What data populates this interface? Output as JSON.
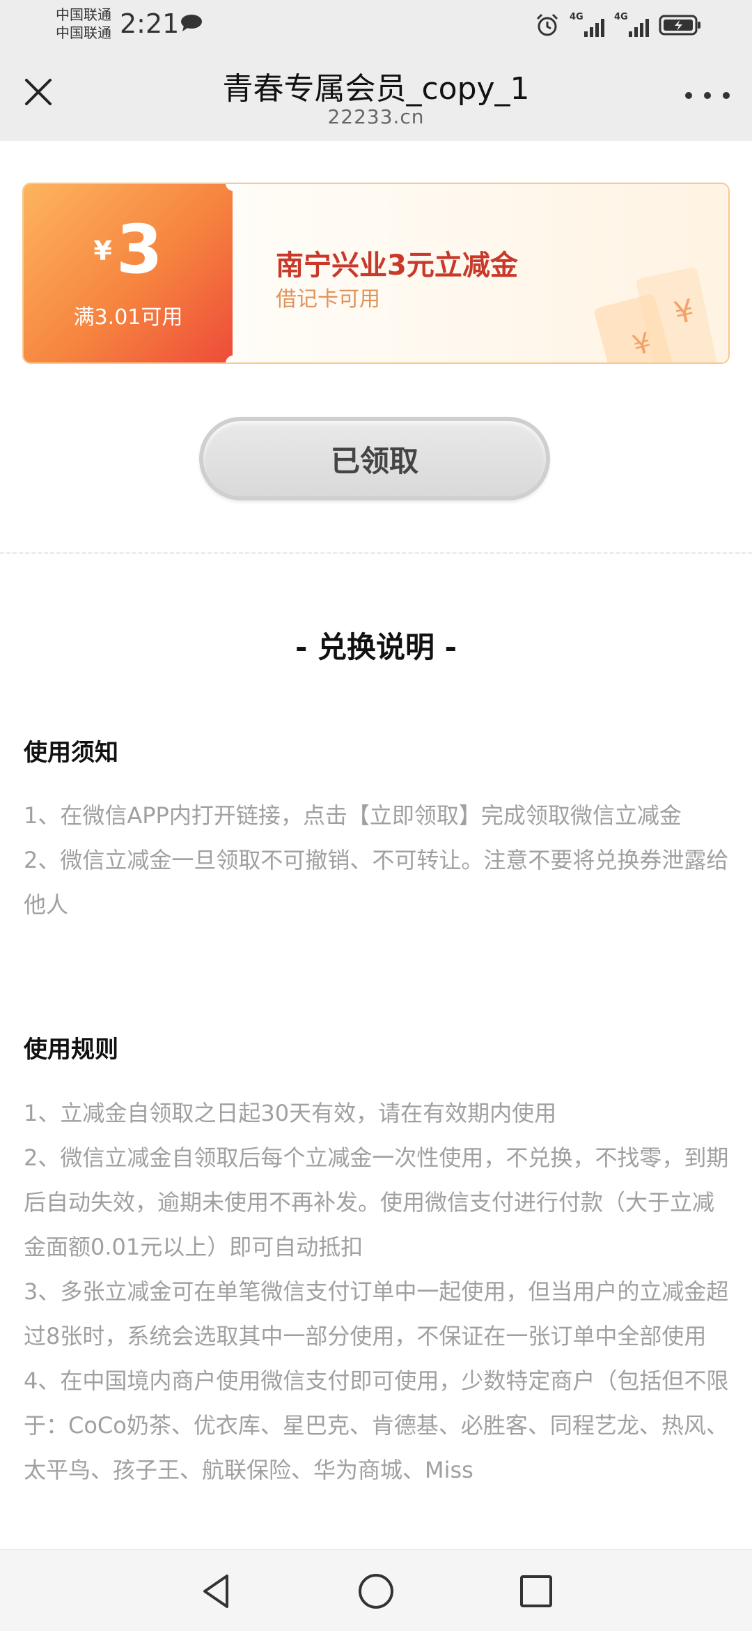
{
  "status_bar": {
    "carrier_1": "中国联通",
    "carrier_2": "中国联通",
    "time": "2:21",
    "network_1": "4G",
    "network_2": "4G"
  },
  "nav": {
    "title": "青春专属会员_copy_1",
    "domain": "22233.cn"
  },
  "coupon": {
    "currency": "¥",
    "amount": "3",
    "threshold": "满3.01可用",
    "title": "南宁兴业3元立减金",
    "subtitle": "借记卡可用"
  },
  "claimed_button": "已领取",
  "section_heading": "- 兑换说明 -",
  "usage_notice": {
    "heading": "使用须知",
    "items": [
      "1、在微信APP内打开链接，点击【立即领取】完成领取微信立减金",
      "2、微信立减金一旦领取不可撤销、不可转让。注意不要将兑换券泄露给他人"
    ]
  },
  "usage_rules": {
    "heading": "使用规则",
    "items": [
      "1、立减金自领取之日起30天有效，请在有效期内使用",
      "2、微信立减金自领取后每个立减金一次性使用，不兑换，不找零，到期后自动失效，逾期未使用不再补发。使用微信支付进行付款（大于立减金面额0.01元以上）即可自动抵扣",
      "3、多张立减金可在单笔微信支付订单中一起使用，但当用户的立减金超过8张时，系统会选取其中一部分使用，不保证在一张订单中全部使用",
      "4、在中国境内商户使用微信支付即可使用，少数特定商户（包括但不限于：CoCo奶茶、优衣库、星巴克、肯德基、必胜客、同程艺龙、热风、太平鸟、孩子王、航联保险、华为商城、Miss"
    ]
  },
  "colors": {
    "coupon_gradient_start": "#fdb45f",
    "coupon_gradient_end": "#ee4b3a",
    "coupon_title": "#c8392b",
    "body_text": "#a0a0a0"
  },
  "icons": [
    "message-icon",
    "alarm-icon",
    "signal-icon",
    "battery-icon",
    "close-icon",
    "more-icon",
    "yen-deco-icon",
    "back-icon",
    "home-icon",
    "recent-apps-icon"
  ]
}
